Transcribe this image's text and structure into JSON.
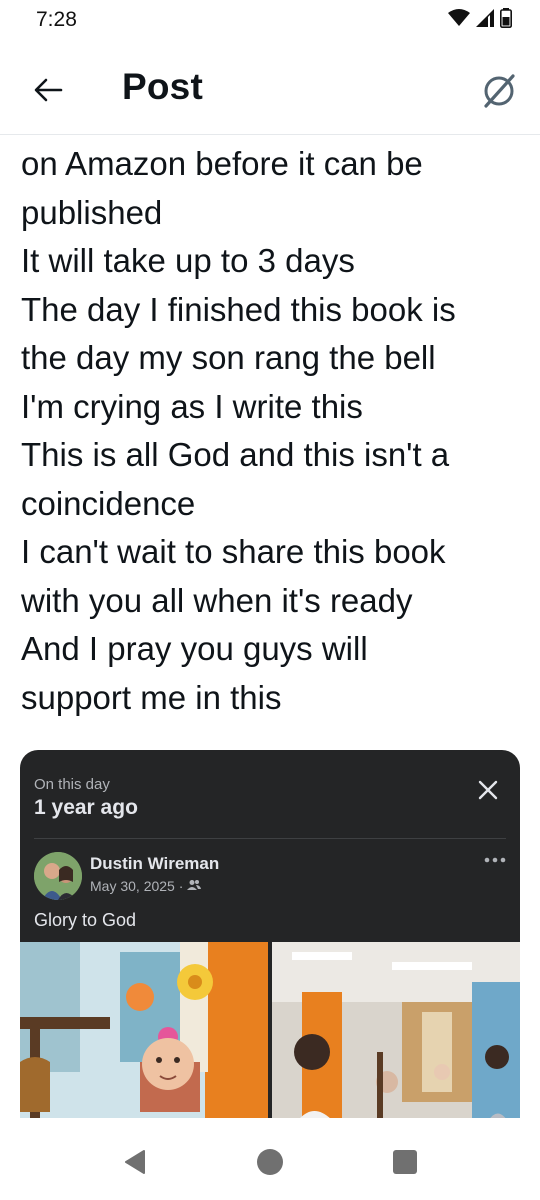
{
  "status_bar": {
    "time": "7:28",
    "icons": [
      "wifi-icon",
      "signal-icon",
      "battery-icon"
    ]
  },
  "header": {
    "back_icon": "arrow-left-icon",
    "title": "Post",
    "grok_icon": "grok-icon"
  },
  "post": {
    "lines": [
      "on Amazon before it can be",
      "published",
      "It will take up to 3 days",
      "The day I finished this book is",
      "the day my son rang the bell",
      "I'm crying as I write this",
      "This is all God and this isn't a",
      "coincidence",
      "I can't wait to share this book",
      "with you all when it's ready",
      "And I pray you guys will",
      "support me in this"
    ]
  },
  "memory_card": {
    "label": "On this day",
    "title": "1 year ago",
    "close_icon": "close-icon",
    "author": "Dustin Wireman",
    "date": "May 30, 2025 ·",
    "audience_icon": "friends-icon",
    "more_icon": "more-icon",
    "text": "Glory to God",
    "photos": [
      "photo-child-bell",
      "photo-hallway-celebration"
    ]
  },
  "colors": {
    "card_bg": "#242526",
    "card_text": "#e4e6eb",
    "card_subtext": "#b0b3b8",
    "grok_accent": "#536471"
  },
  "nav": {
    "icons": [
      "back-triangle-icon",
      "home-circle-icon",
      "recents-square-icon"
    ]
  }
}
